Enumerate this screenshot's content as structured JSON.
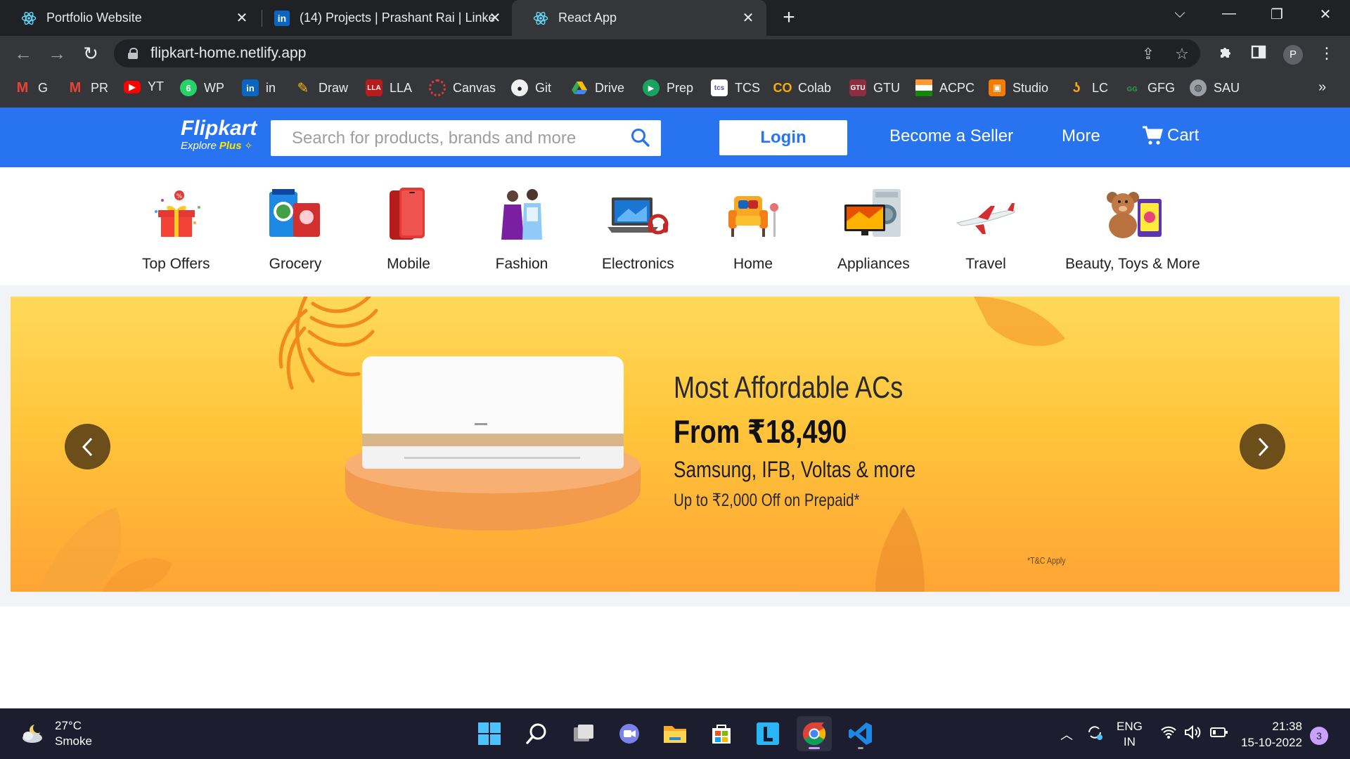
{
  "browser": {
    "tabs": [
      {
        "title": "Portfolio Website",
        "icon": "react-icon",
        "active": false
      },
      {
        "title": "(14) Projects | Prashant Rai | Linke",
        "icon": "linkedin-icon",
        "active": false
      },
      {
        "title": "React App",
        "icon": "react-icon",
        "active": true
      }
    ],
    "url": "flipkart-home.netlify.app",
    "profile_initial": "P",
    "bookmarks": [
      {
        "label": "G",
        "icon": "gmail-icon"
      },
      {
        "label": "PR",
        "icon": "gmail-icon"
      },
      {
        "label": "YT",
        "icon": "youtube-icon"
      },
      {
        "label": "WP",
        "icon": "whatsapp-icon"
      },
      {
        "label": "in",
        "icon": "linkedin-icon"
      },
      {
        "label": "Draw",
        "icon": "draw-icon"
      },
      {
        "label": "LLA",
        "icon": "lla-icon"
      },
      {
        "label": "Canvas",
        "icon": "canvas-icon"
      },
      {
        "label": "Git",
        "icon": "github-icon"
      },
      {
        "label": "Drive",
        "icon": "drive-icon"
      },
      {
        "label": "Prep",
        "icon": "prep-icon"
      },
      {
        "label": "TCS",
        "icon": "tcs-icon"
      },
      {
        "label": "Colab",
        "icon": "colab-icon"
      },
      {
        "label": "GTU",
        "icon": "gtu-icon"
      },
      {
        "label": "ACPC",
        "icon": "india-flag-icon"
      },
      {
        "label": "Studio",
        "icon": "studio-icon"
      },
      {
        "label": "LC",
        "icon": "leetcode-icon"
      },
      {
        "label": "GFG",
        "icon": "gfg-icon"
      },
      {
        "label": "SAU",
        "icon": "globe-icon"
      }
    ]
  },
  "header": {
    "logo": "Flipkart",
    "logo_sub": "Explore",
    "logo_plus": "Plus",
    "search_placeholder": "Search for products, brands and more",
    "login": "Login",
    "seller": "Become a Seller",
    "more": "More",
    "cart": "Cart",
    "colors": {
      "primary": "#2874f0",
      "accent": "#ffe500"
    }
  },
  "categories": [
    {
      "label": "Top Offers",
      "icon": "gift-icon"
    },
    {
      "label": "Grocery",
      "icon": "grocery-icon"
    },
    {
      "label": "Mobile",
      "icon": "mobile-icon"
    },
    {
      "label": "Fashion",
      "icon": "fashion-icon"
    },
    {
      "label": "Electronics",
      "icon": "laptop-icon"
    },
    {
      "label": "Home",
      "icon": "armchair-icon"
    },
    {
      "label": "Appliances",
      "icon": "appliances-icon"
    },
    {
      "label": "Travel",
      "icon": "airplane-icon"
    },
    {
      "label": "Beauty, Toys & More",
      "icon": "teddy-bear-icon"
    }
  ],
  "banner": {
    "line1": "Most Affordable ACs",
    "line2": "From ₹18,490",
    "line3": "Samsung, IFB, Voltas & more",
    "line4": "Up to ₹2,000 Off on Prepaid*",
    "tnc": "*T&C Apply"
  },
  "taskbar": {
    "weather_temp": "27°C",
    "weather_desc": "Smoke",
    "lang_top": "ENG",
    "lang_bottom": "IN",
    "time": "21:38",
    "date": "15-10-2022",
    "notifications": "3"
  }
}
